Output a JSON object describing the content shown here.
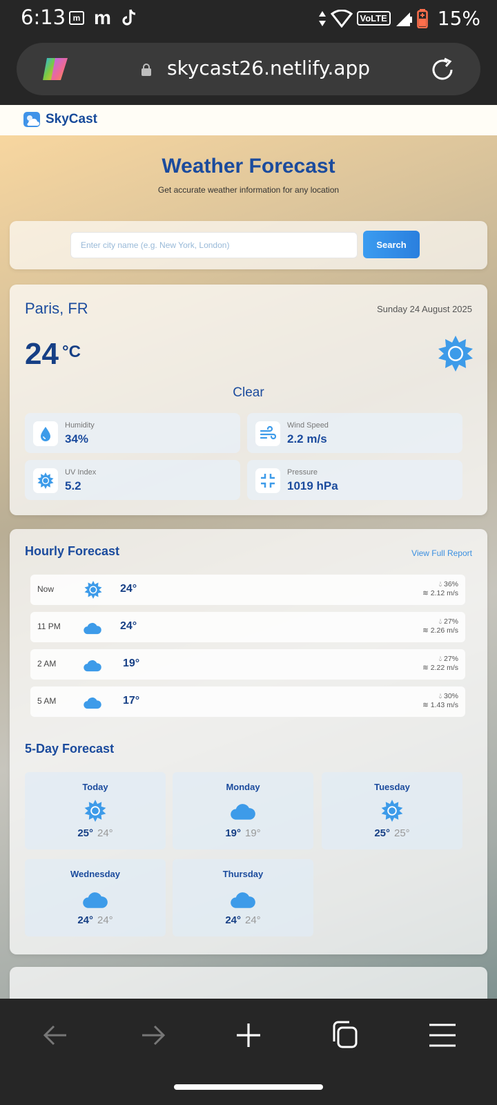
{
  "status_bar": {
    "time": "6:13",
    "network": "VoLTE",
    "battery": "15%"
  },
  "browser": {
    "url": "skycast26.netlify.app"
  },
  "site": {
    "brand": "SkyCast",
    "title": "Weather Forecast",
    "subtitle": "Get accurate weather information for any location"
  },
  "search": {
    "placeholder": "Enter city name (e.g. New York, London)",
    "button_label": "Search"
  },
  "current": {
    "city": "Paris, FR",
    "date": "Sunday 24 August 2025",
    "temp": "24",
    "unit": "°C",
    "condition": "Clear",
    "stats": [
      {
        "label": "Humidity",
        "value": "34%",
        "icon": "droplet-icon"
      },
      {
        "label": "Wind Speed",
        "value": "2.2 m/s",
        "icon": "wind-icon"
      },
      {
        "label": "UV Index",
        "value": "5.2",
        "icon": "sun-icon"
      },
      {
        "label": "Pressure",
        "value": "1019 hPa",
        "icon": "compress-icon"
      }
    ]
  },
  "hourly": {
    "title": "Hourly Forecast",
    "view_full_label": "View Full Report",
    "rows": [
      {
        "time": "Now",
        "icon": "sun-icon",
        "temp": "24°",
        "humidity": "36%",
        "wind": "2.12 m/s"
      },
      {
        "time": "11 PM",
        "icon": "cloud-icon",
        "temp": "24°",
        "humidity": "27%",
        "wind": "2.26 m/s"
      },
      {
        "time": "2 AM",
        "icon": "cloud-icon",
        "temp": "19°",
        "humidity": "27%",
        "wind": "2.22 m/s"
      },
      {
        "time": "5 AM",
        "icon": "cloud-icon",
        "temp": "17°",
        "humidity": "30%",
        "wind": "1.43 m/s"
      }
    ]
  },
  "daily": {
    "title": "5-Day Forecast",
    "days": [
      {
        "name": "Today",
        "icon": "sun-icon",
        "hi": "25°",
        "lo": "24°"
      },
      {
        "name": "Monday",
        "icon": "cloud-icon",
        "hi": "19°",
        "lo": "19°"
      },
      {
        "name": "Tuesday",
        "icon": "sun-icon",
        "hi": "25°",
        "lo": "25°"
      },
      {
        "name": "Wednesday",
        "icon": "cloud-icon",
        "hi": "24°",
        "lo": "24°"
      },
      {
        "name": "Thursday",
        "icon": "cloud-icon",
        "hi": "24°",
        "lo": "24°"
      }
    ]
  },
  "colors": {
    "accent": "#3a8fe0",
    "brand": "#1b4b9d"
  }
}
